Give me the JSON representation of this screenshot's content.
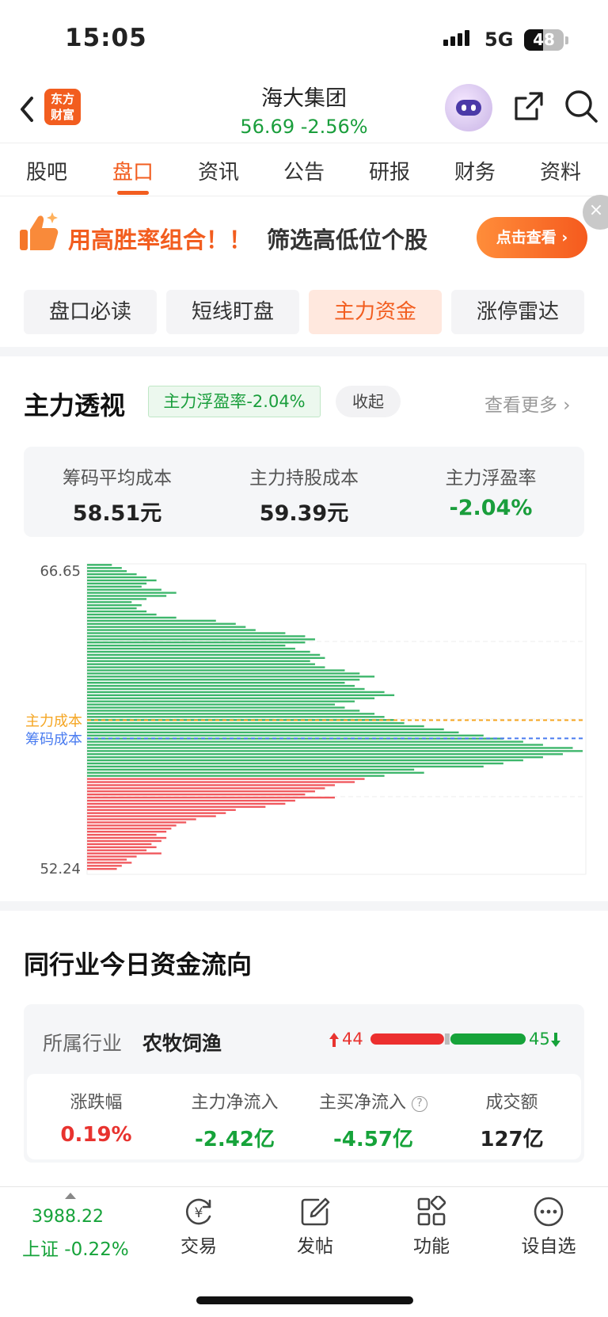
{
  "status_bar": {
    "time": "15:05",
    "network": "5G",
    "battery": "48"
  },
  "header": {
    "logo_text_1": "东方",
    "logo_text_2": "财富",
    "stock_name": "海大集团",
    "price_line": "56.69  -2.56%"
  },
  "tabs": [
    {
      "label": "股吧",
      "active": false
    },
    {
      "label": "盘口",
      "active": true
    },
    {
      "label": "资讯",
      "active": false
    },
    {
      "label": "公告",
      "active": false
    },
    {
      "label": "研报",
      "active": false
    },
    {
      "label": "财务",
      "active": false
    },
    {
      "label": "资料",
      "active": false
    }
  ],
  "banner": {
    "text_orange": "用高胜率组合！！",
    "text_dark": "筛选高低位个股",
    "button": "点击查看 ›",
    "close": "×"
  },
  "segments": [
    {
      "label": "盘口必读",
      "active": false
    },
    {
      "label": "短线盯盘",
      "active": false
    },
    {
      "label": "主力资金",
      "active": true
    },
    {
      "label": "涨停雷达",
      "active": false
    }
  ],
  "main_force": {
    "title": "主力透视",
    "float_pill": "主力浮盈率-2.04%",
    "collapse": "收起",
    "more": "查看更多 ›",
    "stats": [
      {
        "label": "筹码平均成本",
        "value": "58.51元",
        "color": "normal"
      },
      {
        "label": "主力持股成本",
        "value": "59.39元",
        "color": "normal"
      },
      {
        "label": "主力浮盈率",
        "value": "-2.04%",
        "color": "green"
      }
    ]
  },
  "chart_data": {
    "type": "bar",
    "orientation": "horizontal",
    "title": "",
    "ylim": [
      52.24,
      66.65
    ],
    "ytick_labels": [
      "66.65",
      "52.24"
    ],
    "reference_lines": [
      {
        "label": "主力成本",
        "value": 59.39,
        "color": "#f5a623",
        "style": "dashed"
      },
      {
        "label": "筹码成本",
        "value": 58.51,
        "color": "#4a7cf0",
        "style": "dashed"
      }
    ],
    "current_price": 56.69,
    "colors": {
      "above": "#3db66b",
      "below": "#f0595e"
    },
    "note": "chip distribution",
    "y": [
      66.9,
      66.75,
      66.6,
      66.45,
      66.3,
      66.15,
      66.0,
      65.85,
      65.7,
      65.55,
      65.4,
      65.25,
      65.1,
      64.95,
      64.8,
      64.65,
      64.5,
      64.35,
      64.2,
      64.05,
      63.9,
      63.75,
      63.6,
      63.45,
      63.3,
      63.15,
      63.0,
      62.85,
      62.7,
      62.55,
      62.4,
      62.25,
      62.1,
      61.95,
      61.8,
      61.65,
      61.5,
      61.35,
      61.2,
      61.05,
      60.9,
      60.75,
      60.6,
      60.45,
      60.3,
      60.15,
      60.0,
      59.85,
      59.7,
      59.55,
      59.4,
      59.25,
      59.1,
      58.95,
      58.8,
      58.65,
      58.5,
      58.35,
      58.2,
      58.05,
      57.9,
      57.75,
      57.6,
      57.45,
      57.3,
      57.15,
      57.0,
      56.85,
      56.7,
      56.55,
      56.4,
      56.25,
      56.1,
      55.95,
      55.8,
      55.65,
      55.5,
      55.35,
      55.2,
      55.05,
      54.9,
      54.75,
      54.6,
      54.45,
      54.3,
      54.15,
      54.0,
      53.85,
      53.7,
      53.55,
      53.4,
      53.25,
      53.1,
      52.95,
      52.8,
      52.65,
      52.5,
      52.35,
      52.2
    ],
    "values": [
      5,
      7,
      8,
      10,
      12,
      14,
      12,
      11,
      15,
      18,
      16,
      12,
      9,
      11,
      10,
      12,
      14,
      18,
      26,
      30,
      32,
      34,
      40,
      44,
      46,
      44,
      40,
      42,
      45,
      47,
      48,
      45,
      46,
      48,
      52,
      55,
      58,
      55,
      52,
      54,
      56,
      60,
      62,
      58,
      54,
      50,
      52,
      55,
      58,
      60,
      62,
      64,
      68,
      72,
      75,
      80,
      84,
      88,
      92,
      98,
      100,
      96,
      92,
      88,
      84,
      80,
      66,
      68,
      60,
      56,
      54,
      50,
      48,
      46,
      44,
      50,
      42,
      40,
      36,
      30,
      28,
      26,
      22,
      20,
      18,
      17,
      16,
      14,
      16,
      15,
      13,
      14,
      12,
      15,
      10,
      8,
      9,
      7,
      6
    ]
  },
  "industry": {
    "title": "同行业今日资金流向",
    "label": "所属行业",
    "name": "农牧饲渔",
    "up_count": "44",
    "down_count": "45",
    "up_ratio": 0.494,
    "cells": [
      {
        "label": "涨跌幅",
        "value": "0.19%",
        "color": "red"
      },
      {
        "label": "主力净流入",
        "value": "-2.42亿",
        "color": "green"
      },
      {
        "label": "主买净流入",
        "value": "-4.57亿",
        "color": "green"
      },
      {
        "label": "成交额",
        "value": "127亿",
        "color": "normal"
      }
    ]
  },
  "bottom_nav": {
    "index_value": "3988.22",
    "index_label": "上证 -0.22%",
    "items": [
      {
        "label": "交易",
        "icon": "yuan-refresh-icon"
      },
      {
        "label": "发帖",
        "icon": "edit-icon"
      },
      {
        "label": "功能",
        "icon": "grid-icon"
      },
      {
        "label": "设自选",
        "icon": "more-dots-icon"
      }
    ]
  }
}
